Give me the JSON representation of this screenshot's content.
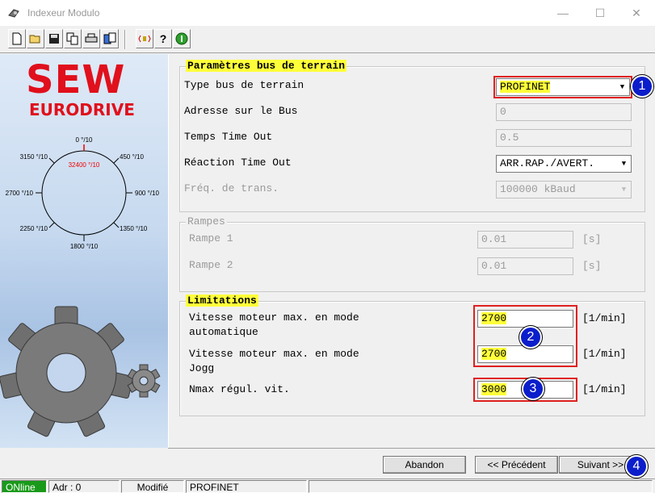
{
  "window": {
    "title": "Indexeur Modulo"
  },
  "logo": {
    "line1": "SEW",
    "line2": "EURODRIVE"
  },
  "dial": {
    "top": "0 °/10",
    "center": "32400 °/10",
    "top_right": "450 °/10",
    "right": "900 °/10",
    "bottom_right": "1350 °/10",
    "bottom": "1800 °/10",
    "bottom_left": "2250 °/10",
    "left": "2700 °/10",
    "top_left": "3150 °/10"
  },
  "fieldbus": {
    "title": "Paramètres bus de terrain",
    "type_label": "Type bus de terrain",
    "type_value": "PROFINET",
    "address_label": "Adresse sur le Bus",
    "address_value": "0",
    "timeout_label": "Temps Time Out",
    "timeout_value": "0.5",
    "reaction_label": "Réaction Time Out",
    "reaction_value": "ARR.RAP./AVERT.",
    "freq_label": "Fréq. de trans.",
    "freq_value": "100000 kBaud"
  },
  "ramps": {
    "title": "Rampes",
    "ramp1_label": "Rampe 1",
    "ramp1_value": "0.01",
    "ramp1_unit": "[s]",
    "ramp2_label": "Rampe 2",
    "ramp2_value": "0.01",
    "ramp2_unit": "[s]"
  },
  "limits": {
    "title": "Limitations",
    "auto_label_1": "Vitesse moteur max. en mode",
    "auto_label_2": "automatique",
    "auto_value": "2700",
    "auto_unit": "[1/min]",
    "jogg_label_1": "Vitesse moteur max. en mode",
    "jogg_label_2": "Jogg",
    "jogg_value": "2700",
    "jogg_unit": "[1/min]",
    "nmax_label": "Nmax régul. vit.",
    "nmax_value": "3000",
    "nmax_unit": "[1/min]"
  },
  "badges": {
    "b1": "1",
    "b2": "2",
    "b3": "3",
    "b4": "4"
  },
  "buttons": {
    "abandon": "Abandon",
    "previous": "<< Précédent",
    "next": "Suivant >>"
  },
  "status": {
    "online": "ONline",
    "address": "Adr : 0",
    "modified": "Modifié",
    "bus": "PROFINET"
  },
  "colors": {
    "highlight": "#ffff3a",
    "annotation_box": "#e02020",
    "badge": "#0b1ecb",
    "online": "#1a9a1a",
    "logo": "#e0101c"
  }
}
